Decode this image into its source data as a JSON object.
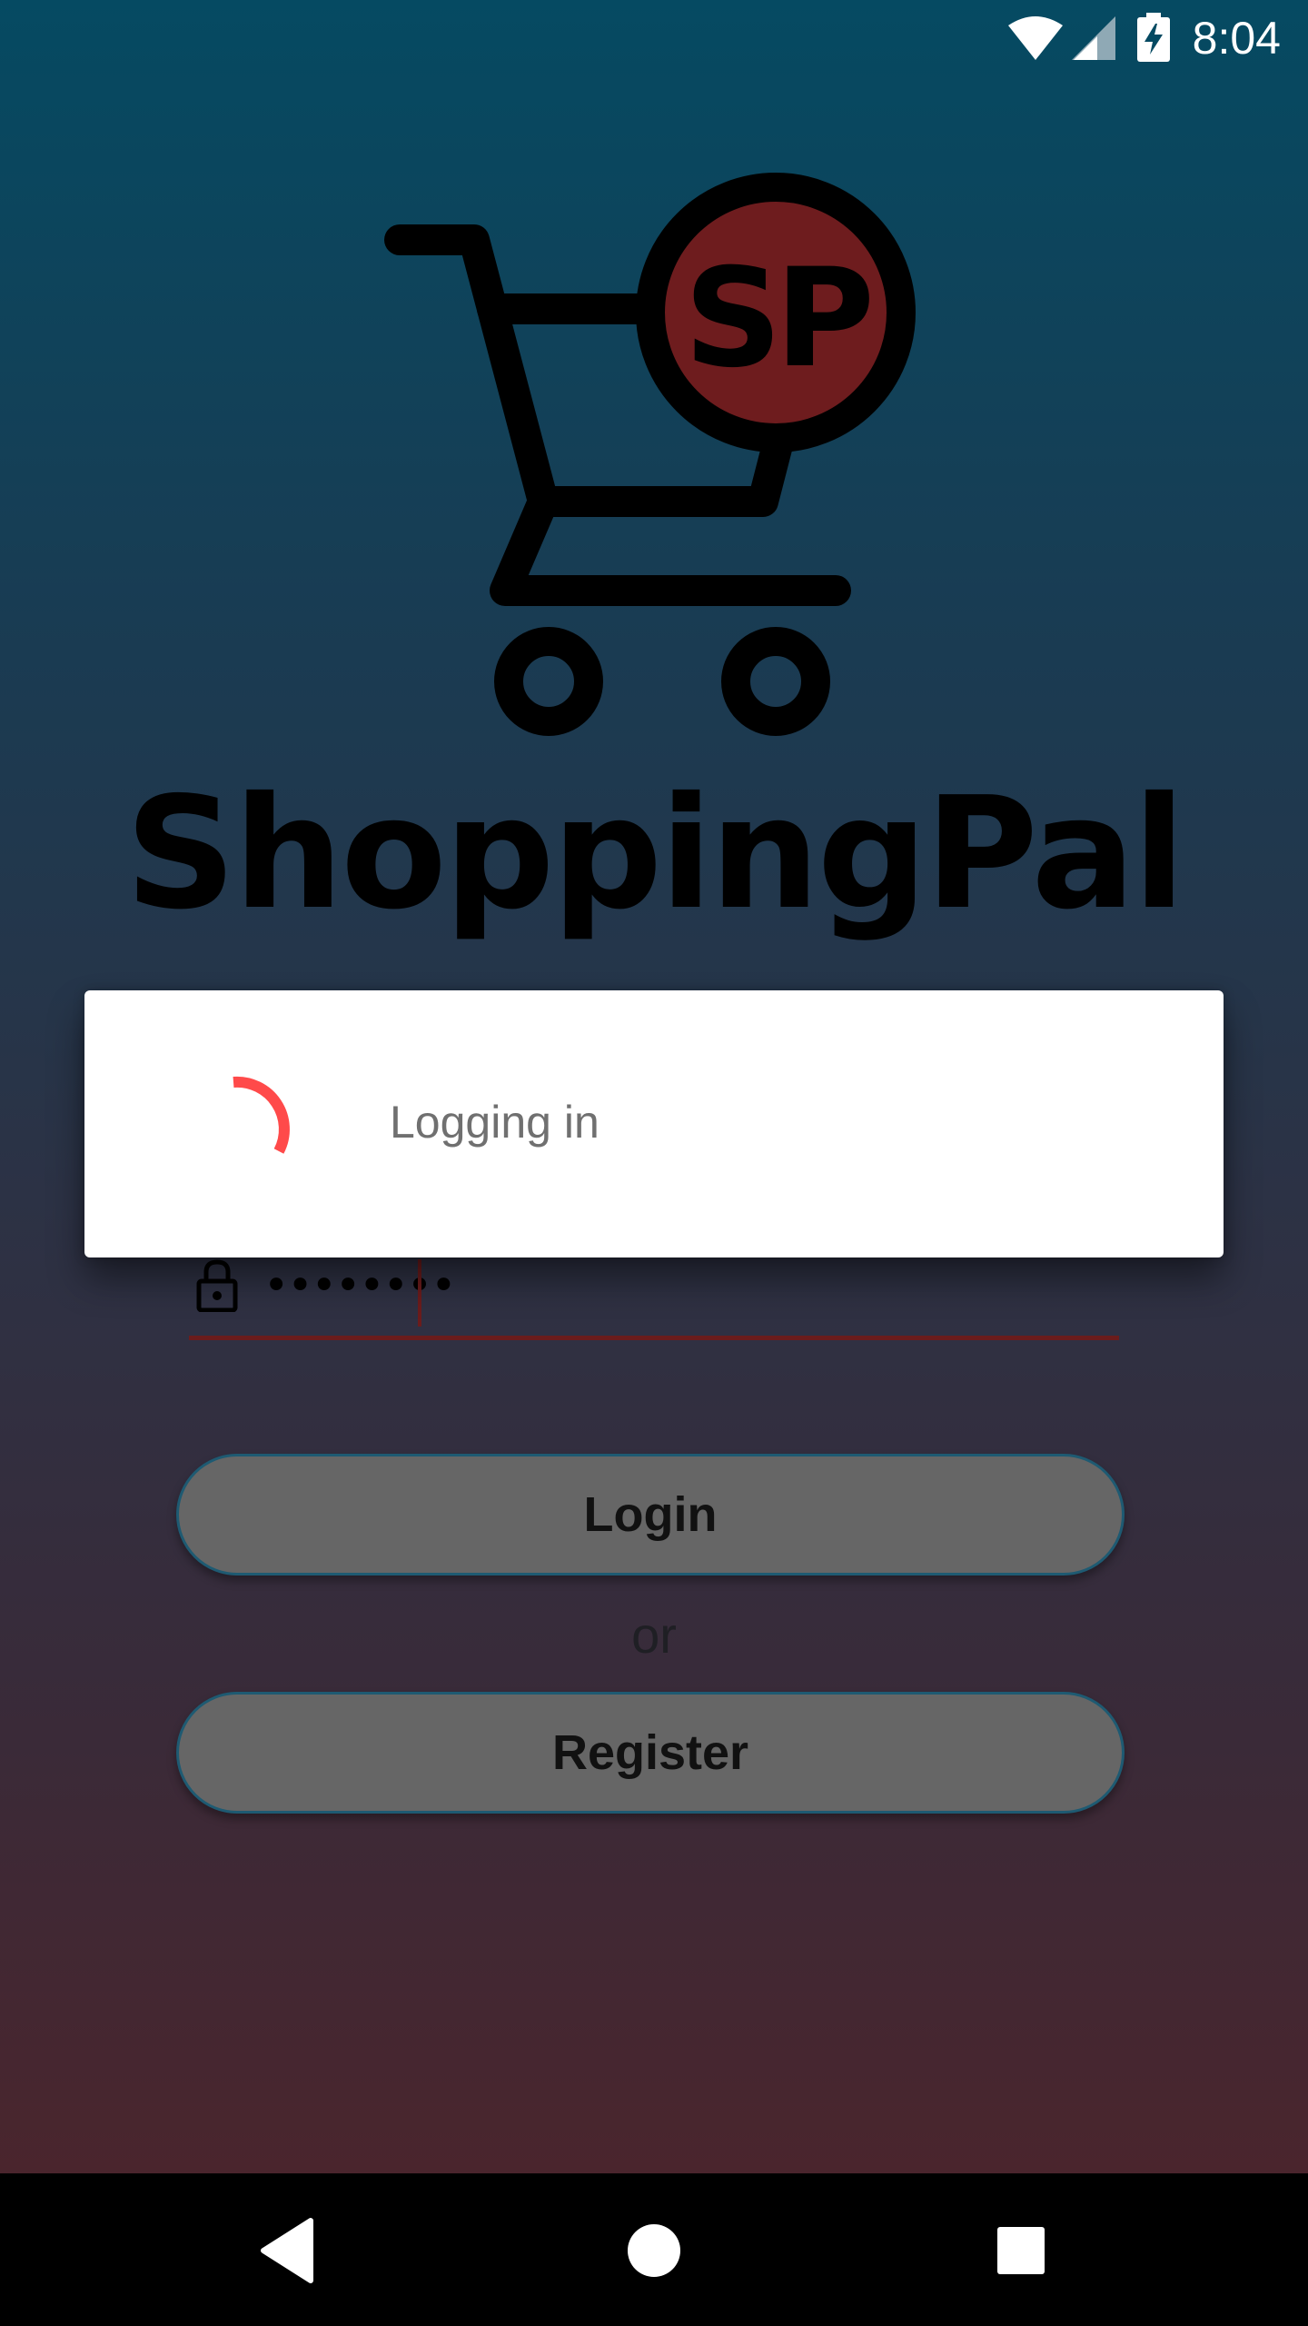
{
  "status_bar": {
    "time": "8:04",
    "icons": [
      "wifi-icon",
      "cell-signal-icon",
      "battery-charging-icon"
    ]
  },
  "brand": {
    "logo_monogram": "SP",
    "name": "ShoppingPal"
  },
  "login_form": {
    "password_icon": "lock-icon",
    "password_masked": "••••••••",
    "login_label": "Login",
    "or_label": "or",
    "register_label": "Register"
  },
  "dialog": {
    "message": "Logging in",
    "spinner_color": "#ff4a4a"
  },
  "nav_bar": {
    "icons": [
      "back-icon",
      "home-icon",
      "recents-icon"
    ]
  },
  "colors": {
    "gradient_top": "#054a62",
    "gradient_bottom": "#4a252d",
    "logo_accent": "#6e1c1e",
    "field_underline": "#6b1c1c",
    "button_fill": "#666666",
    "button_border": "#1e5a72"
  }
}
